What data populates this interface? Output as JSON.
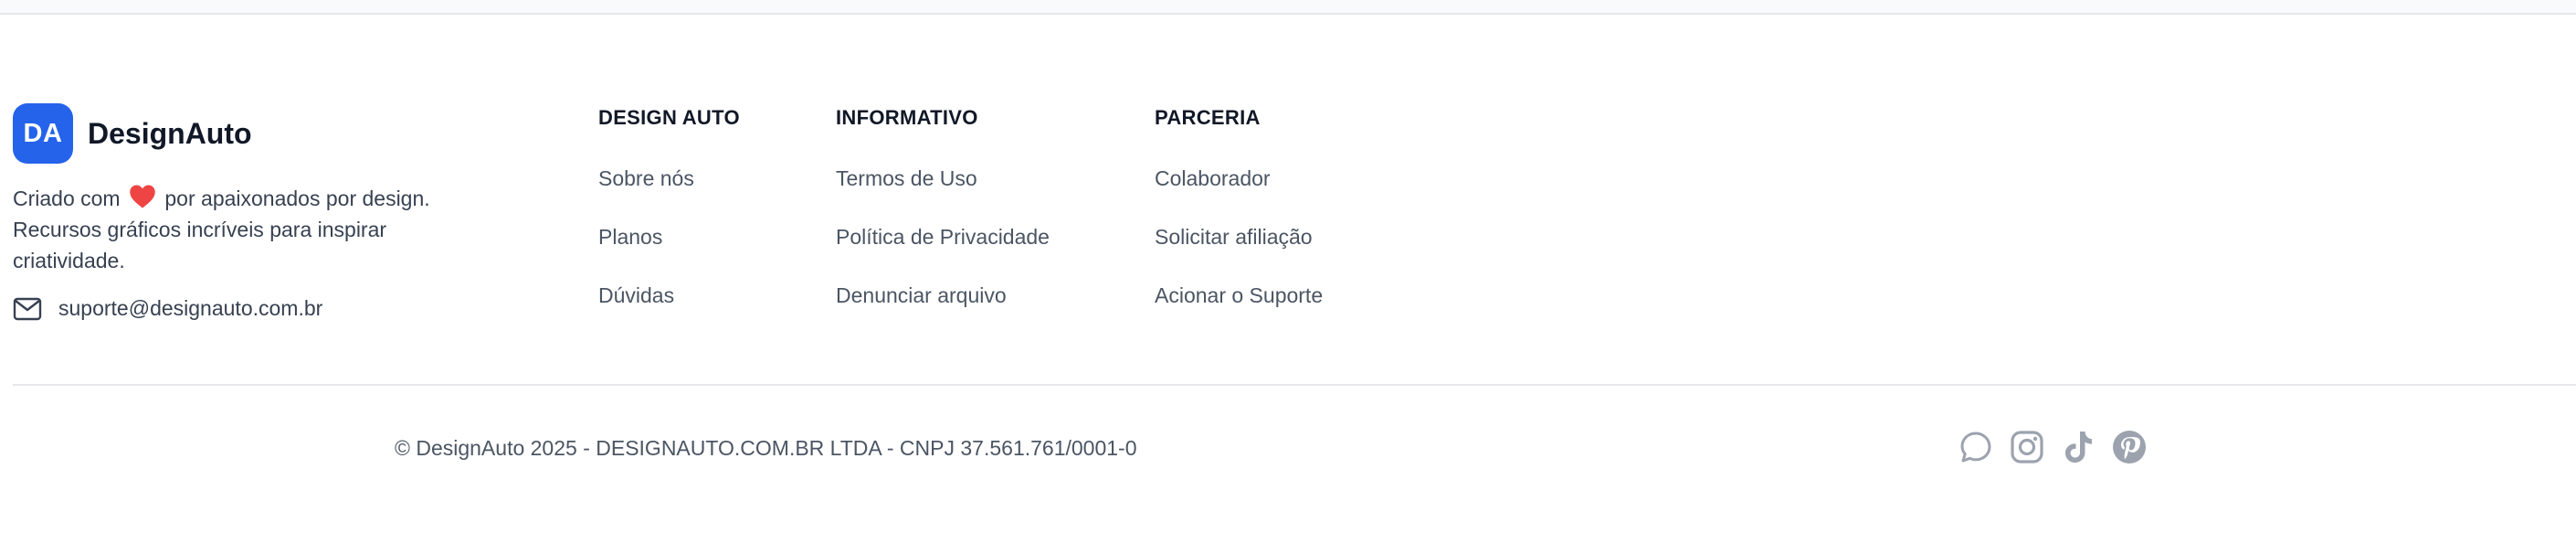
{
  "brand": {
    "logo_initials": "DA",
    "name": "DesignAuto",
    "tagline_before_heart": "Criado com",
    "tagline_after_heart": "por apaixonados por design. Recursos gráficos incríveis para inspirar criatividade.",
    "email": "suporte@designauto.com.br"
  },
  "columns": [
    {
      "title": "DESIGN AUTO",
      "links": [
        "Sobre nós",
        "Planos",
        "Dúvidas"
      ]
    },
    {
      "title": "INFORMATIVO",
      "links": [
        "Termos de Uso",
        "Política de Privacidade",
        "Denunciar arquivo"
      ]
    },
    {
      "title": "PARCERIA",
      "links": [
        "Colaborador",
        "Solicitar afiliação",
        "Acionar o Suporte"
      ]
    }
  ],
  "footer": {
    "copyright": "© DesignAuto 2025 - DESIGNAUTO.COM.BR LTDA - CNPJ 37.561.761/0001-0",
    "socials": [
      "chat-icon",
      "instagram-icon",
      "tiktok-icon",
      "pinterest-icon"
    ]
  },
  "colors": {
    "accent": "#2563eb",
    "heart": "#ef4444",
    "social_icon": "#9ca3af"
  }
}
